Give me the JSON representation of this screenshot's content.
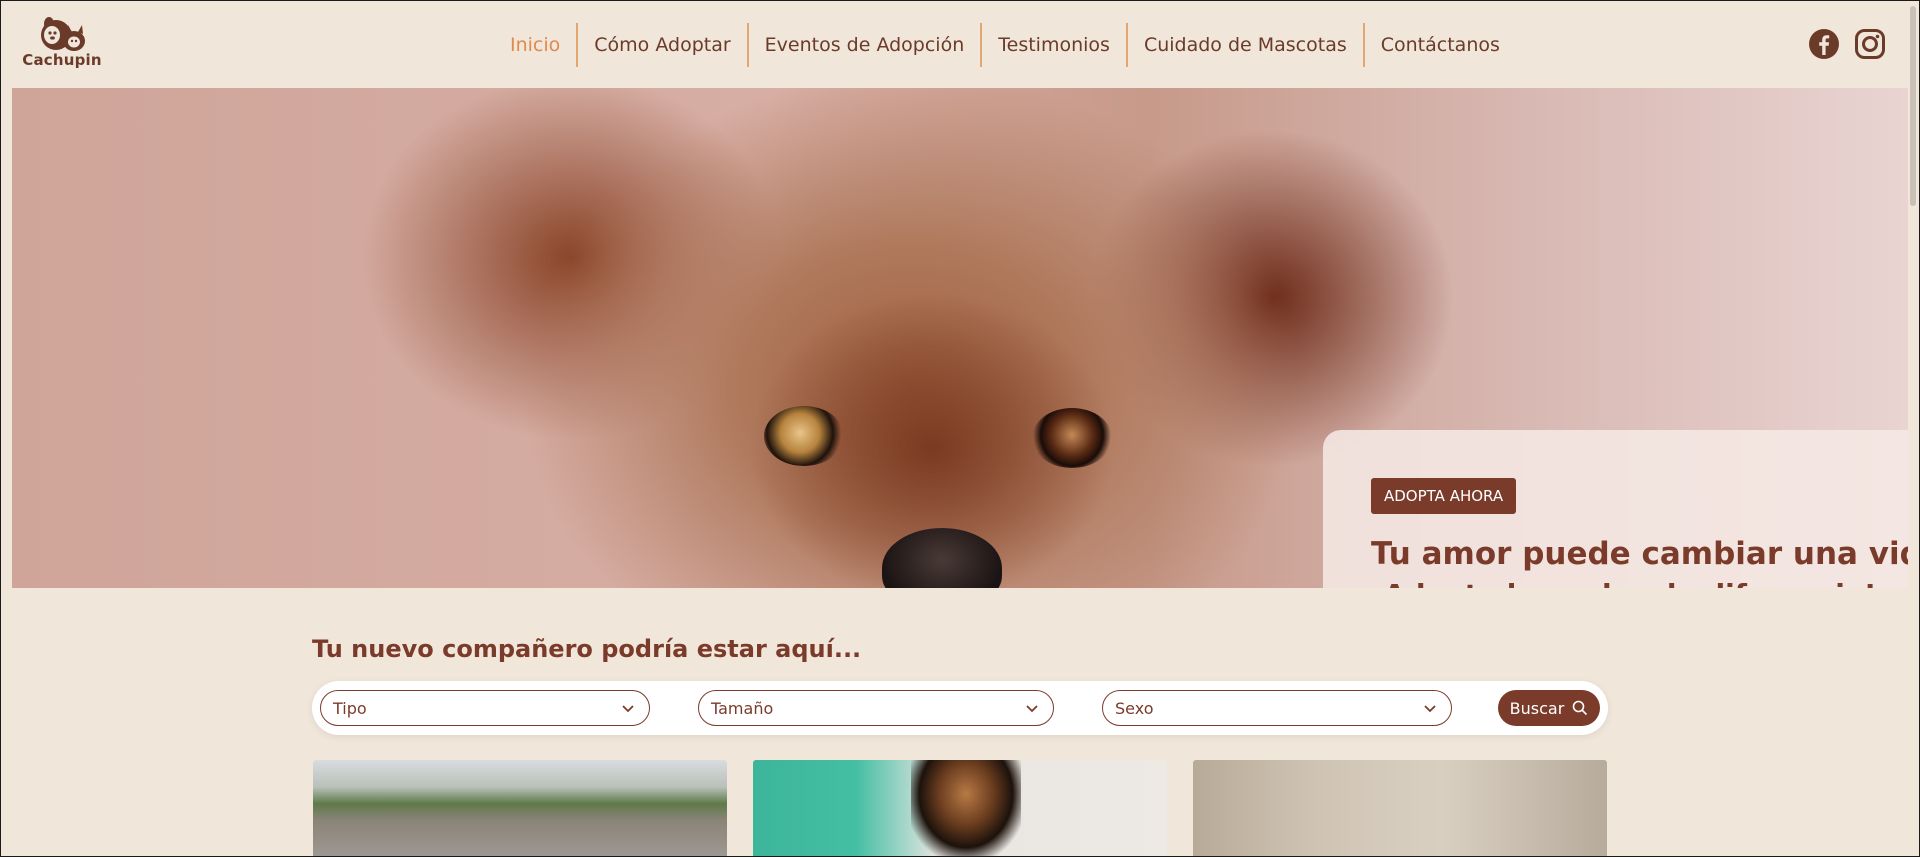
{
  "brand": {
    "logo_text": "Cachupin"
  },
  "nav": {
    "items": [
      {
        "label": "Inicio"
      },
      {
        "label": "Cómo Adoptar"
      },
      {
        "label": "Eventos de Adopción"
      },
      {
        "label": "Testimonios"
      },
      {
        "label": "Cuidado de Mascotas"
      },
      {
        "label": "Contáctanos"
      }
    ]
  },
  "social": {
    "icons": [
      "facebook-icon",
      "instagram-icon"
    ]
  },
  "hero": {
    "cta_label": "ADOPTA AHORA",
    "title": "Tu amor puede cambiar una vida",
    "subtitle": "¡Adopta hoy y haz la diferencia!"
  },
  "search": {
    "title": "Tu nuevo compañero podría estar aquí...",
    "filters": {
      "tipo": "Tipo",
      "tamano": "Tamaño",
      "sexo": "Sexo"
    },
    "button_label": "Buscar"
  },
  "colors": {
    "background": "#f1e6da",
    "brand_brown": "#7a3b2b",
    "nav_active": "#e08a4c",
    "nav_divider": "#e0a870"
  }
}
